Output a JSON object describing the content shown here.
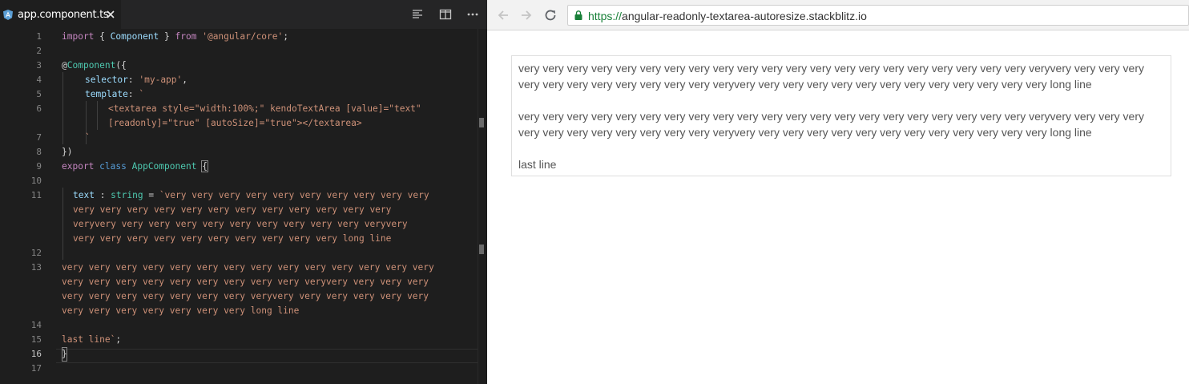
{
  "editor": {
    "tab": {
      "label": "app.component.ts"
    },
    "toolbar_icons": [
      "align-left-icon",
      "split-editor-icon",
      "more-icon"
    ],
    "line_numbers": [
      "1",
      "2",
      "3",
      "4",
      "5",
      "6",
      "7",
      "8",
      "9",
      "10",
      "11",
      "12",
      "13",
      "14",
      "15",
      "16",
      "17"
    ],
    "active_line": "16",
    "code": {
      "l1_kw": "import",
      "l1_b1": "{ ",
      "l1_id": "Component",
      "l1_b2": " }",
      "l1_from": "from",
      "l1_str": "'@angular/core'",
      "l1_semi": ";",
      "l3_at": "@",
      "l3_fn": "Component",
      "l3_p": "({",
      "l4_key": "selector",
      "l4_colon": ": ",
      "l4_val": "'my-app'",
      "l4_comma": ",",
      "l5_key": "template",
      "l5_colon": ": ",
      "l5_tick": "`",
      "l6_text": "<textarea style=\"width:100%;\" kendoTextArea [value]=\"text\"",
      "l6b_text": "[readonly]=\"true\" [autoSize]=\"true\"></textarea>",
      "l7_tick": "`",
      "l8_close": "})",
      "l9_export": "export",
      "l9_class": "class",
      "l9_name": "AppComponent",
      "l9_brace": "{",
      "l11_id": "text",
      "l11_colon": " : ",
      "l11_type": "string",
      "l11_eq": " = ",
      "l11_s1": "`very very very very very very very very very very",
      "l11_s2": "very very very very very very very very very very very very",
      "l11_s3": "veryvery very very very very very very very very very veryvery",
      "l11_s4": "very very very very very very very very very very long line",
      "l13_s1": "very very very very very very very very very very very very very very",
      "l13_s2": "very very very very very very very very very veryvery very very very",
      "l13_s3": "very very very very very very very veryvery very very very very very",
      "l13_s4": "very very very very very very very long line",
      "l15_s": "last line`",
      "l15_semi": ";",
      "l16_brace": "}"
    }
  },
  "browser": {
    "nav_icons": [
      "back-arrow-icon",
      "forward-arrow-icon",
      "reload-icon"
    ],
    "url_scheme": "https://",
    "url_host": "angular-readonly-textarea-autoresize.stackblitz.io",
    "textarea_value": "very very very very very very very very very very very very very very very very very very very very very veryvery very very very very very very very very very very very veryvery very very very very very very very very very very very very long line\n\nvery very very very very very very very very very very very very very very very very very very very very veryvery very very very very very very very very very very very veryvery very very very very very very very very very very very very long line\n\nlast line"
  },
  "colors": {
    "editor_bg": "#1e1e1e",
    "keyword": "#c586c0",
    "keyword_blue": "#569cd6",
    "type": "#4ec9b0",
    "identifier": "#9cdcfe",
    "function": "#dcdcaa",
    "string": "#ce9178",
    "angular_red": "#dd0031",
    "secure_green": "#188038"
  }
}
